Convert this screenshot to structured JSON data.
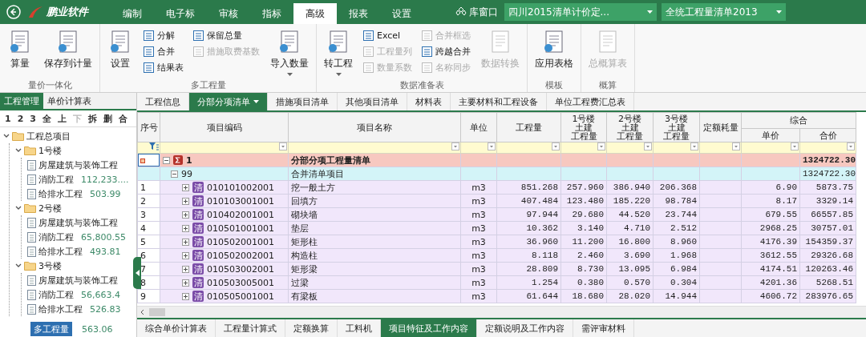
{
  "title_bar": {
    "brand": "鹏业软件",
    "tabs": [
      {
        "label": "编制",
        "selected": false
      },
      {
        "label": "电子标",
        "selected": false
      },
      {
        "label": "审核",
        "selected": false
      },
      {
        "label": "指标",
        "selected": false
      },
      {
        "label": "高级",
        "selected": true
      },
      {
        "label": "报表",
        "selected": false
      },
      {
        "label": "设置",
        "selected": false
      }
    ],
    "library_button": "库窗口",
    "selects": [
      "四川2015清单计价定...",
      "全统工程量清单2013"
    ]
  },
  "ribbon": [
    {
      "label": "量价一体化",
      "items": [
        {
          "kind": "large",
          "label": "算量",
          "disabled": false,
          "dropdown": false
        },
        {
          "kind": "large",
          "label": "保存到计量",
          "disabled": false,
          "dropdown": false
        }
      ]
    },
    {
      "label": "多工程量",
      "items": [
        {
          "kind": "large",
          "label": "设置",
          "disabled": false,
          "dropdown": false
        },
        {
          "kind": "stack",
          "entries": [
            {
              "label": "分解",
              "disabled": false
            },
            {
              "label": "合并",
              "disabled": false
            },
            {
              "label": "结果表",
              "disabled": false
            }
          ]
        },
        {
          "kind": "stack",
          "entries": [
            {
              "label": "保留总量",
              "disabled": false
            },
            {
              "label": "措施取费基数",
              "disabled": true
            }
          ]
        },
        {
          "kind": "large",
          "label": "导入数量",
          "disabled": false,
          "dropdown": true
        }
      ]
    },
    {
      "label": "数据准备表",
      "items": [
        {
          "kind": "large",
          "label": "转工程",
          "disabled": false,
          "dropdown": true
        },
        {
          "kind": "stack",
          "entries": [
            {
              "label": "Excel",
              "disabled": false
            },
            {
              "label": "工程量列",
              "disabled": true
            },
            {
              "label": "数量系数",
              "disabled": true
            }
          ]
        },
        {
          "kind": "stack",
          "entries": [
            {
              "label": "合并框选",
              "disabled": true
            },
            {
              "label": "跨越合并",
              "disabled": false
            },
            {
              "label": "名称同步",
              "disabled": true
            }
          ]
        },
        {
          "kind": "large",
          "label": "数据转换",
          "disabled": true,
          "dropdown": false
        }
      ]
    },
    {
      "label": "模板",
      "items": [
        {
          "kind": "large",
          "label": "应用表格",
          "disabled": false,
          "dropdown": false
        }
      ]
    },
    {
      "label": "概算",
      "items": [
        {
          "kind": "large",
          "label": "总概算表",
          "disabled": true,
          "dropdown": false
        }
      ]
    }
  ],
  "sidebar": {
    "tabs": [
      {
        "label": "工程管理",
        "selected": true
      },
      {
        "label": "单价计算表",
        "selected": false
      }
    ],
    "tools": [
      {
        "label": "1",
        "disabled": false
      },
      {
        "label": "2",
        "disabled": false
      },
      {
        "label": "3",
        "disabled": false
      },
      {
        "label": "全",
        "disabled": false
      },
      {
        "label": "上",
        "disabled": false
      },
      {
        "label": "下",
        "disabled": true
      },
      {
        "label": "拆",
        "disabled": false
      },
      {
        "label": "删",
        "disabled": false
      },
      {
        "label": "合",
        "disabled": false
      }
    ],
    "tree": [
      {
        "name": "工程总项目",
        "expanded": true,
        "children": [
          {
            "name": "1号楼",
            "expanded": true,
            "children": [
              {
                "name": "房屋建筑与装饰工程"
              },
              {
                "name": "消防工程",
                "value": "112,233...."
              },
              {
                "name": "给排水工程",
                "value": "503.99"
              }
            ]
          },
          {
            "name": "2号楼",
            "expanded": true,
            "children": [
              {
                "name": "房屋建筑与装饰工程"
              },
              {
                "name": "消防工程",
                "value": "65,800.55"
              },
              {
                "name": "给排水工程",
                "value": "493.81"
              }
            ]
          },
          {
            "name": "3号楼",
            "expanded": true,
            "children": [
              {
                "name": "房屋建筑与装饰工程"
              },
              {
                "name": "消防工程",
                "value": "56,663.4"
              },
              {
                "name": "给排水工程",
                "value": "526.83"
              }
            ]
          }
        ]
      }
    ],
    "bottom_tab": "多工程量",
    "bottom_value": "563.06"
  },
  "main_tabs": [
    {
      "label": "工程信息",
      "selected": false
    },
    {
      "label": "分部分项清单",
      "selected": true
    },
    {
      "label": "措施项目清单",
      "selected": false
    },
    {
      "label": "其他项目清单",
      "selected": false
    },
    {
      "label": "材料表",
      "selected": false
    },
    {
      "label": "主要材料和工程设备",
      "selected": false
    },
    {
      "label": "单位工程费汇总表",
      "selected": false
    }
  ],
  "table": {
    "columns": [
      {
        "label": "序号"
      },
      {
        "label": "项目编码"
      },
      {
        "label": "项目名称"
      },
      {
        "label": "单位"
      },
      {
        "label": "工程量"
      },
      {
        "lines": [
          "1号楼",
          "土建",
          "工程量"
        ]
      },
      {
        "lines": [
          "2号楼",
          "土建",
          "工程量"
        ]
      },
      {
        "lines": [
          "3号楼",
          "土建",
          "工程量"
        ]
      },
      {
        "label": "定额耗量"
      },
      {
        "label": "综合",
        "children": [
          {
            "label": "单价"
          },
          {
            "label": "合价"
          }
        ]
      }
    ],
    "rows": [
      {
        "kind": "section",
        "selected": true,
        "expanded": true,
        "code": "1",
        "name": "分部分项工程量清单",
        "total": "1324722.30"
      },
      {
        "kind": "group",
        "selected": false,
        "expanded": true,
        "code": "99",
        "name": "合并清单项目",
        "total": "1324722.30"
      },
      {
        "kind": "item",
        "selected": false,
        "expanded": false,
        "seq": "1",
        "badge": "清",
        "code": "010101002001",
        "name": "挖一般土方",
        "unit": "m3",
        "qty": "851.268",
        "b1": "257.960",
        "b2": "386.940",
        "b3": "206.368",
        "price": "6.90",
        "total": "5873.75"
      },
      {
        "kind": "item",
        "selected": false,
        "expanded": false,
        "seq": "2",
        "badge": "清",
        "code": "010103001001",
        "name": "回填方",
        "unit": "m3",
        "qty": "407.484",
        "b1": "123.480",
        "b2": "185.220",
        "b3": "98.784",
        "price": "8.17",
        "total": "3329.14"
      },
      {
        "kind": "item",
        "selected": false,
        "expanded": false,
        "seq": "3",
        "badge": "清",
        "code": "010402001001",
        "name": "砌块墙",
        "unit": "m3",
        "qty": "97.944",
        "b1": "29.680",
        "b2": "44.520",
        "b3": "23.744",
        "price": "679.55",
        "total": "66557.85"
      },
      {
        "kind": "item",
        "selected": false,
        "expanded": false,
        "seq": "4",
        "badge": "清",
        "code": "010501001001",
        "name": "垫层",
        "unit": "m3",
        "qty": "10.362",
        "b1": "3.140",
        "b2": "4.710",
        "b3": "2.512",
        "price": "2968.25",
        "total": "30757.01"
      },
      {
        "kind": "item",
        "selected": false,
        "expanded": false,
        "seq": "5",
        "badge": "清",
        "code": "010502001001",
        "name": "矩形柱",
        "unit": "m3",
        "qty": "36.960",
        "b1": "11.200",
        "b2": "16.800",
        "b3": "8.960",
        "price": "4176.39",
        "total": "154359.37"
      },
      {
        "kind": "item",
        "selected": false,
        "expanded": false,
        "seq": "6",
        "badge": "清",
        "code": "010502002001",
        "name": "构造柱",
        "unit": "m3",
        "qty": "8.118",
        "b1": "2.460",
        "b2": "3.690",
        "b3": "1.968",
        "price": "3612.55",
        "total": "29326.68"
      },
      {
        "kind": "item",
        "selected": false,
        "expanded": false,
        "seq": "7",
        "badge": "清",
        "code": "010503002001",
        "name": "矩形梁",
        "unit": "m3",
        "qty": "28.809",
        "b1": "8.730",
        "b2": "13.095",
        "b3": "6.984",
        "price": "4174.51",
        "total": "120263.46"
      },
      {
        "kind": "item",
        "selected": false,
        "expanded": false,
        "seq": "8",
        "badge": "清",
        "code": "010503005001",
        "name": "过梁",
        "unit": "m3",
        "qty": "1.254",
        "b1": "0.380",
        "b2": "0.570",
        "b3": "0.304",
        "price": "4201.36",
        "total": "5268.51"
      },
      {
        "kind": "item",
        "selected": false,
        "expanded": false,
        "seq": "9",
        "badge": "清",
        "code": "010505001001",
        "name": "有梁板",
        "unit": "m3",
        "qty": "61.644",
        "b1": "18.680",
        "b2": "28.020",
        "b3": "14.944",
        "price": "4606.72",
        "total": "283976.65"
      }
    ]
  },
  "bottom_tabs": [
    {
      "label": "综合单价计算表",
      "selected": false
    },
    {
      "label": "工程量计算式",
      "selected": false
    },
    {
      "label": "定额换算",
      "selected": false
    },
    {
      "label": "工料机",
      "selected": false
    },
    {
      "label": "项目特征及工作内容",
      "selected": true
    },
    {
      "label": "定额说明及工作内容",
      "selected": false
    },
    {
      "label": "需评审材料",
      "selected": false
    }
  ]
}
